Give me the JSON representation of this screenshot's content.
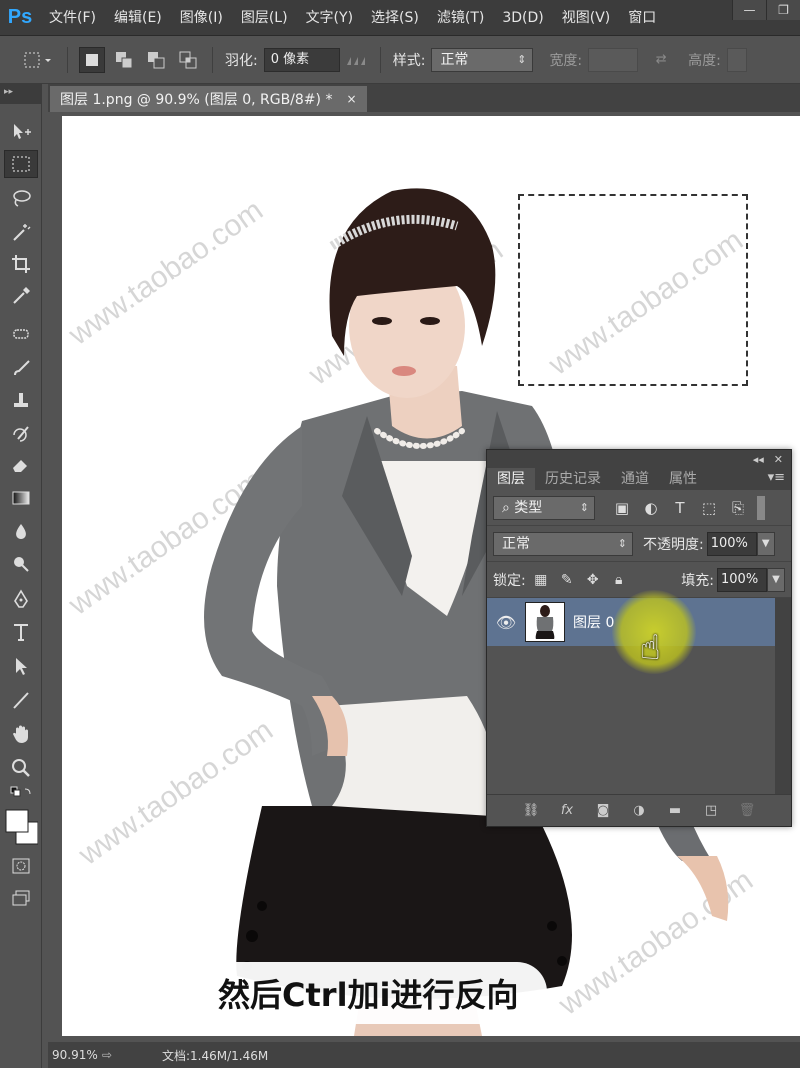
{
  "app": {
    "logo": "Ps"
  },
  "menu": [
    "文件(F)",
    "编辑(E)",
    "图像(I)",
    "图层(L)",
    "文字(Y)",
    "选择(S)",
    "滤镜(T)",
    "3D(D)",
    "视图(V)",
    "窗口"
  ],
  "options_bar": {
    "feather_label": "羽化:",
    "feather_value": "0 像素",
    "style_label": "样式:",
    "style_value": "正常",
    "width_label": "宽度:",
    "height_label": "高度:"
  },
  "document_tab": {
    "title": "图层 1.png @ 90.9% (图层 0, RGB/8#) *",
    "close": "×"
  },
  "canvas": {
    "watermark": "www.taobao.com"
  },
  "caption": "然后Ctrl加i进行反向",
  "status_bar": {
    "zoom": "90.91%",
    "doc_info": "文档:1.46M/1.46M"
  },
  "layers_panel": {
    "tabs": [
      "图层",
      "历史记录",
      "通道",
      "属性"
    ],
    "active_tab": "图层",
    "filter_type": "类型",
    "blend_mode": "正常",
    "opacity_label": "不透明度:",
    "opacity_value": "100%",
    "lock_label": "锁定:",
    "fill_label": "填充:",
    "fill_value": "100%",
    "layers": [
      {
        "name": "图层 0",
        "visible": true,
        "selected": true
      }
    ]
  },
  "colors": {
    "menu_bg": "#3c3c3c",
    "panel_bg": "#535353",
    "selected_layer": "#5e7391",
    "ps_blue": "#31a8ff",
    "cursor_highlight": "#cdd228"
  }
}
